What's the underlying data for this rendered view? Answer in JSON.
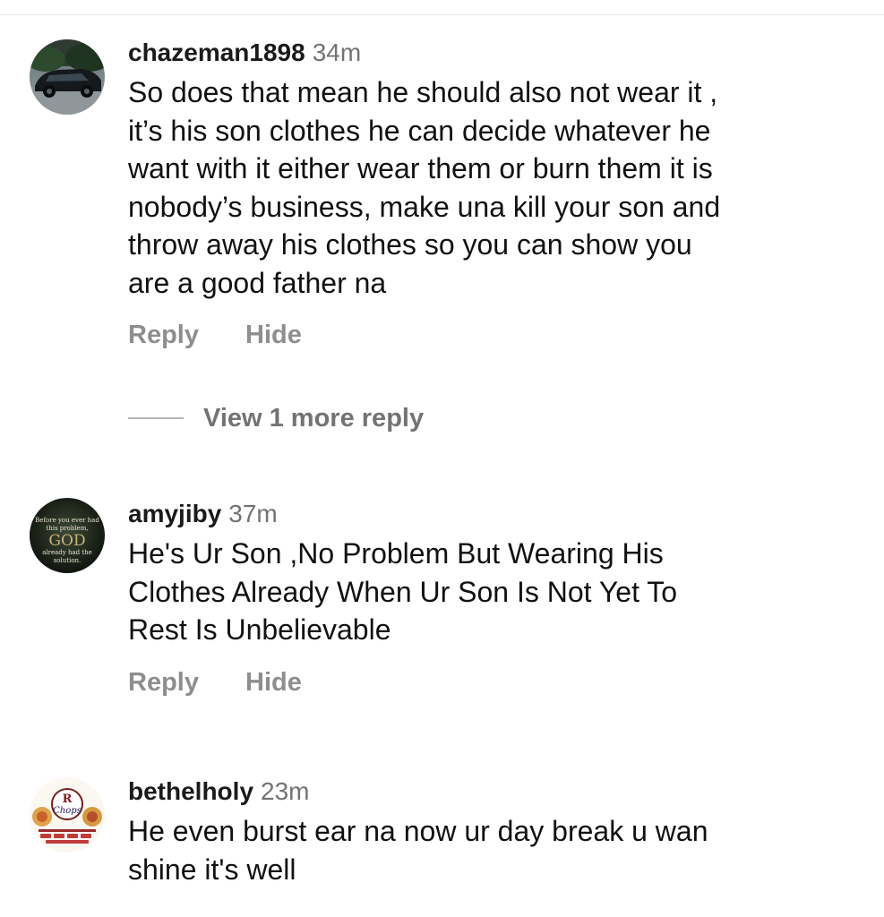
{
  "comments": [
    {
      "username": "chazeman1898",
      "time": "34m",
      "text_lines": [
        "So does that mean he should also not wear it ,",
        "it’s his son clothes he can decide whatever he",
        "want with it either wear them or burn them it is",
        "nobody’s business, make una kill your son and",
        "throw away his clothes so you can show you",
        "are a good father na"
      ],
      "reply_label": "Reply",
      "hide_label": "Hide",
      "view_more_label": "View 1 more reply"
    },
    {
      "username": "amyjiby",
      "time": "37m",
      "avatar_text": [
        "Before you ever had",
        "this problem,",
        "GOD",
        "already had the",
        "solution."
      ],
      "text_lines": [
        "He's Ur Son ,No Problem But Wearing His",
        "Clothes Already When Ur Son Is Not Yet To",
        "Rest Is Unbelievable"
      ],
      "reply_label": "Reply",
      "hide_label": "Hide"
    },
    {
      "username": "bethelholy",
      "time": "23m",
      "avatar_text": [
        "R",
        "Chops"
      ],
      "text_lines": [
        "He even burst ear na now ur day break u wan",
        "shine it's well"
      ]
    }
  ]
}
